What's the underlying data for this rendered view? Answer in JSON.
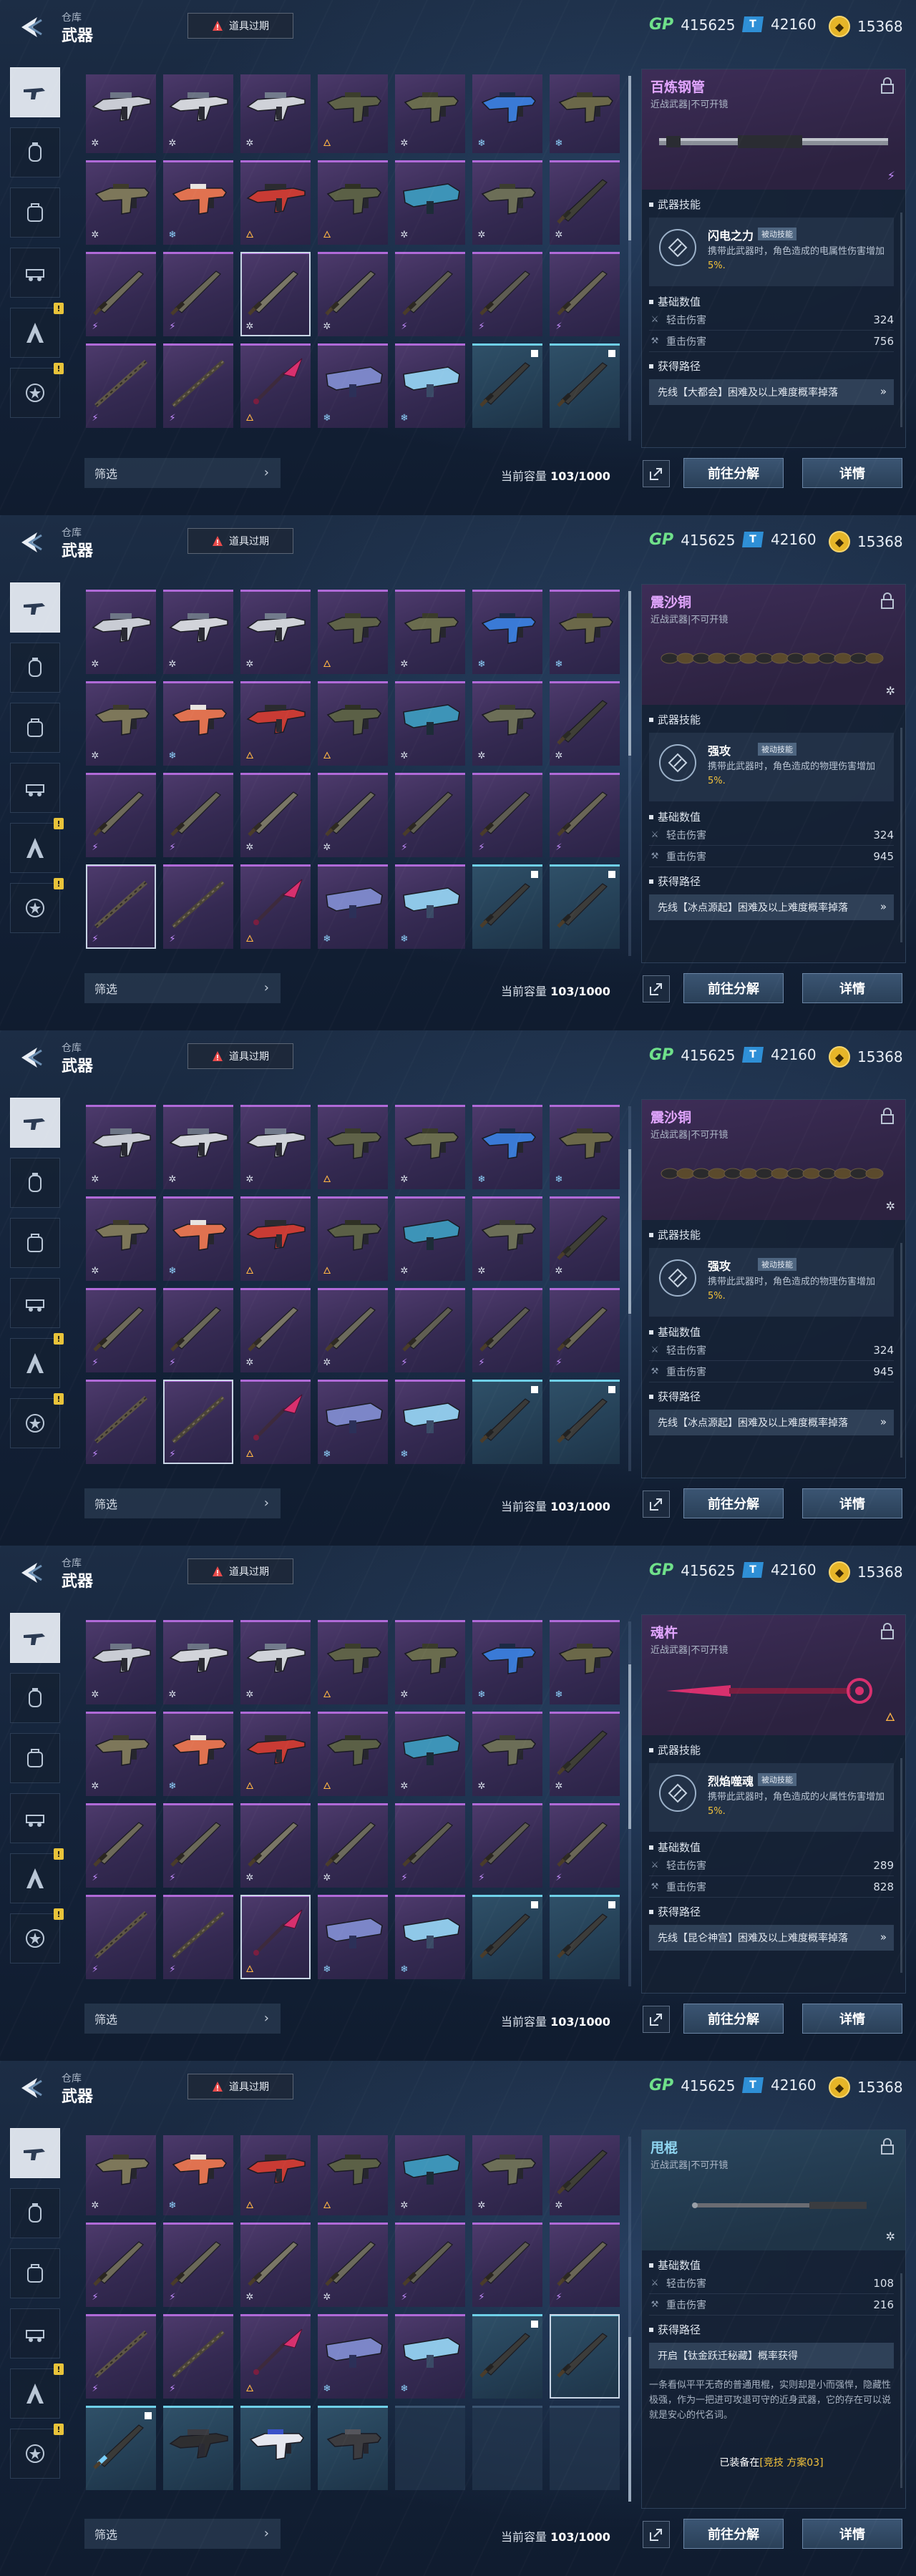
{
  "header": {
    "breadcrumb_parent": "仓库",
    "page_title": "武器",
    "expired_notice": "道具过期",
    "currency_gp_icon": "GP",
    "currency_gp": "415625",
    "currency_ticket_icon": "T",
    "currency_ticket": "42160",
    "currency_coin": "15368"
  },
  "footer": {
    "filter_label": "筛选",
    "capacity_label": "当前容量",
    "capacity_value": "103/1000",
    "decompose_label": "前往分解",
    "detail_label": "详情"
  },
  "rail_icons": [
    "gun-icon",
    "grenade-icon",
    "backpack-icon",
    "vehicle-icon",
    "character-icon",
    "badge-icon"
  ],
  "colors": {
    "epic_purple": "#b06ad8",
    "rare_teal": "#6fd0e8",
    "gold_highlight": "#f2c23c",
    "gp_green": "#6fe08a"
  },
  "panel_common": {
    "skill_section": "武器技能",
    "stats_section": "基础数值",
    "route_section": "获得路径",
    "light_damage_label": "轻击伤害",
    "heavy_damage_label": "重击伤害",
    "passive_tag": "被动技能"
  },
  "screens": [
    {
      "weapon": {
        "name": "百炼钢管",
        "type": "近战武器|不可开镜",
        "skill_name": "闪电之力",
        "skill_desc": "携带此武器时，角色造成的电属性伤害增加",
        "skill_pct": "5%.",
        "light_damage": "324",
        "heavy_damage": "756",
        "route": "先线【大都会】困难及以上难度概率掉落"
      }
    },
    {
      "weapon": {
        "name": "震沙铜",
        "type": "近战武器|不可开镜",
        "skill_name": "强攻",
        "skill_desc": "携带此武器时，角色造成的物理伤害增加",
        "skill_pct": "5%.",
        "light_damage": "324",
        "heavy_damage": "945",
        "route": "先线【冰点源起】困难及以上难度概率掉落"
      }
    },
    {
      "weapon": {
        "name": "震沙铜",
        "type": "近战武器|不可开镜",
        "skill_name": "强攻",
        "skill_desc": "携带此武器时，角色造成的物理伤害增加",
        "skill_pct": "5%.",
        "light_damage": "324",
        "heavy_damage": "945",
        "route": "先线【冰点源起】困难及以上难度概率掉落"
      }
    },
    {
      "weapon": {
        "name": "魂杵",
        "type": "近战武器|不可开镜",
        "skill_name": "烈焰噬魂",
        "skill_desc": "携带此武器时，角色造成的火属性伤害增加",
        "skill_pct": "5%.",
        "light_damage": "289",
        "heavy_damage": "828",
        "route": "先线【昆仑神宫】困难及以上难度概率掉落"
      }
    },
    {
      "weapon": {
        "name": "甩棍",
        "type": "近战武器|不可开镜",
        "light_damage": "108",
        "heavy_damage": "216",
        "route": "开启【钛金跃迁秘藏】概率获得",
        "flavor": "一条看似平平无奇的普通甩棍，实则却是小而强悍，隐藏性极强，作为一把进可攻退可守的近身武器，它的存在可以说就是安心的代名词。",
        "equipped_prefix": "已装备在",
        "equipped_loadout": "[竞技 方案03]"
      }
    }
  ]
}
